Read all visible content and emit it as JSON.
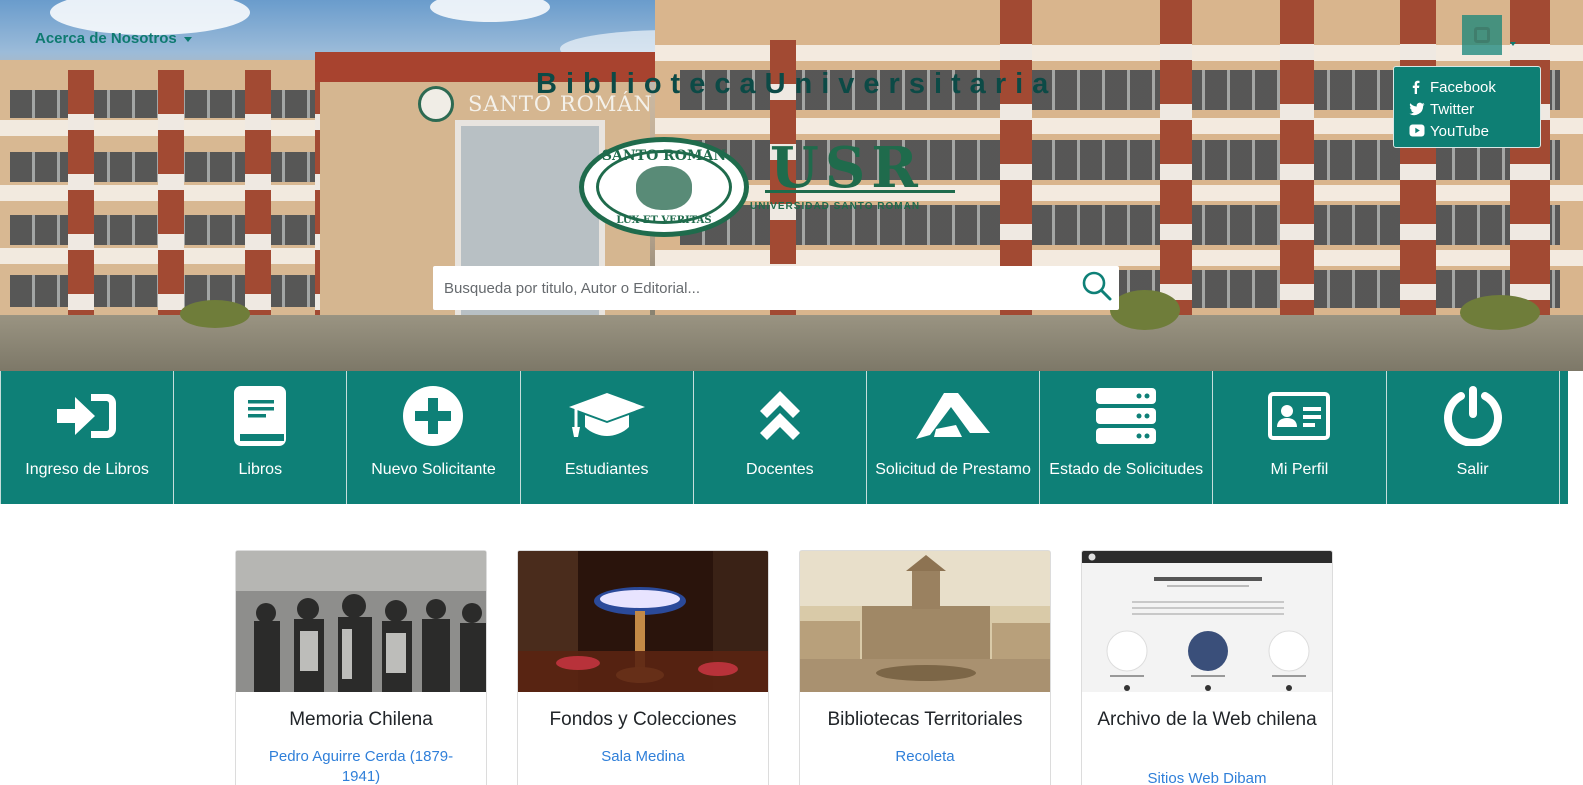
{
  "nav": {
    "about_label": "Acerca de Nosotros"
  },
  "site": {
    "title": "BibliotecaUniversitaria",
    "photo_sign": "SANTO ROMÁN",
    "logo_seal_top": "SANTO ROMAN",
    "logo_seal_bottom": "LUX ET VERITAS",
    "logo_mark": "USR",
    "logo_subtitle": "UNIVERSIDAD SANTO ROMAN"
  },
  "social": {
    "items": [
      {
        "label": "Facebook",
        "icon": "facebook-icon"
      },
      {
        "label": "Twitter",
        "icon": "twitter-icon"
      },
      {
        "label": "YouTube",
        "icon": "youtube-icon"
      }
    ]
  },
  "search": {
    "placeholder": "Busqueda por titulo, Autor o Editorial...",
    "icon": "search-icon"
  },
  "tiles": [
    {
      "label": "Ingreso de Libros",
      "icon": "sign-in-icon"
    },
    {
      "label": "Libros",
      "icon": "book-icon"
    },
    {
      "label": "Nuevo Solicitante",
      "icon": "plus-circle-icon"
    },
    {
      "label": "Estudiantes",
      "icon": "graduation-cap-icon"
    },
    {
      "label": "Docentes",
      "icon": "chevrons-up-icon"
    },
    {
      "label": "Solicitud de Prestamo",
      "icon": "triangle-logo-icon"
    },
    {
      "label": "Estado de Solicitudes",
      "icon": "server-icon"
    },
    {
      "label": "Mi Perfil",
      "icon": "id-card-icon"
    },
    {
      "label": "Salir",
      "icon": "power-icon"
    }
  ],
  "cards": [
    {
      "title": "Memoria Chilena",
      "link": "Pedro Aguirre Cerda (1879-1941)"
    },
    {
      "title": "Fondos y Colecciones",
      "link": "Sala Medina"
    },
    {
      "title": "Bibliotecas Territoriales",
      "link": "Recoleta"
    },
    {
      "title": "Archivo de la Web chilena",
      "link": "Sitios Web Dibam"
    }
  ],
  "colors": {
    "brand": "#0e8077",
    "link": "#2f7fd9",
    "title": "#0c4a46"
  }
}
